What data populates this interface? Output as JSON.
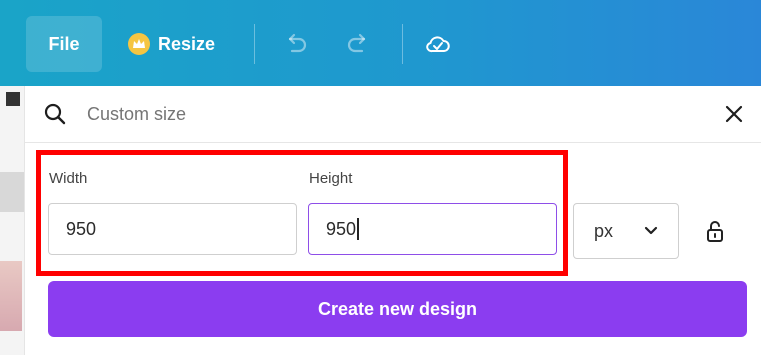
{
  "toolbar": {
    "file_label": "File",
    "resize_label": "Resize",
    "undo_icon": "undo-icon",
    "redo_icon": "redo-icon",
    "save_status_icon": "cloud-check-icon"
  },
  "custom_size": {
    "search_placeholder": "Custom size",
    "width_label": "Width",
    "height_label": "Height",
    "width_value": "950",
    "height_value": "950",
    "unit": "px",
    "create_button": "Create new design"
  },
  "colors": {
    "toolbar_gradient_start": "#1aa4c8",
    "toolbar_gradient_end": "#2a87d8",
    "primary_button": "#8b3df0",
    "active_field_border": "#8e4ee8",
    "highlight_box": "#ff0000"
  }
}
